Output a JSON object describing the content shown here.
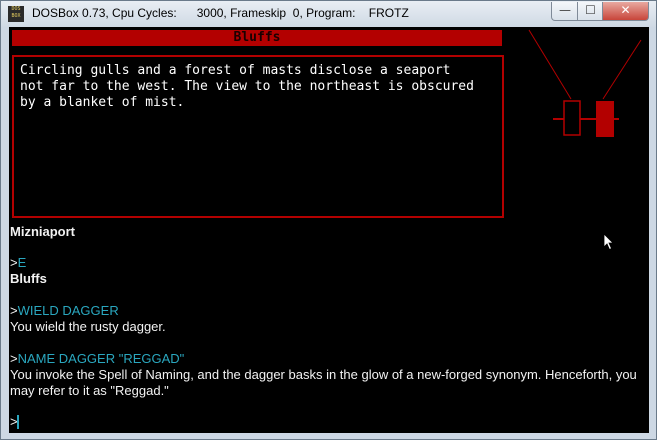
{
  "window": {
    "icon_text": "DOS BOX",
    "title": "DOSBox 0.73, Cpu Cycles:      3000, Frameskip  0, Program:    FROTZ",
    "minimize_symbol": "—",
    "maximize_symbol": "☐",
    "close_symbol": "✕"
  },
  "game": {
    "room_title": "Bluffs",
    "description": "Circling gulls and a forest of masts disclose a seaport\nnot far to the west. The view to the northeast is obscured\nby a blanket of mist.",
    "transcript": {
      "location_1": "Mizniaport",
      "prompt_1": ">",
      "command_1": "E",
      "location_2": "Bluffs",
      "prompt_2": ">",
      "command_2": "WIELD DAGGER",
      "response_2": "You wield the rusty dagger.",
      "prompt_3": ">",
      "command_3": "NAME DAGGER \"REGGAD\"",
      "response_3_line1": "You invoke the Spell of Naming, and the dagger basks in the glow of a new-forged synonym. Henceforth, you",
      "response_3_line2": "may refer to it as \"Reggad.\"",
      "prompt_4": ">"
    }
  },
  "colors": {
    "accent_red": "#b30000",
    "command_cyan": "#2aa7bf",
    "text_white": "#f2f2f2"
  },
  "icons": [
    "dosbox-app-icon",
    "minimize-icon",
    "maximize-icon",
    "close-icon",
    "map-icon",
    "mouse-pointer-icon"
  ]
}
